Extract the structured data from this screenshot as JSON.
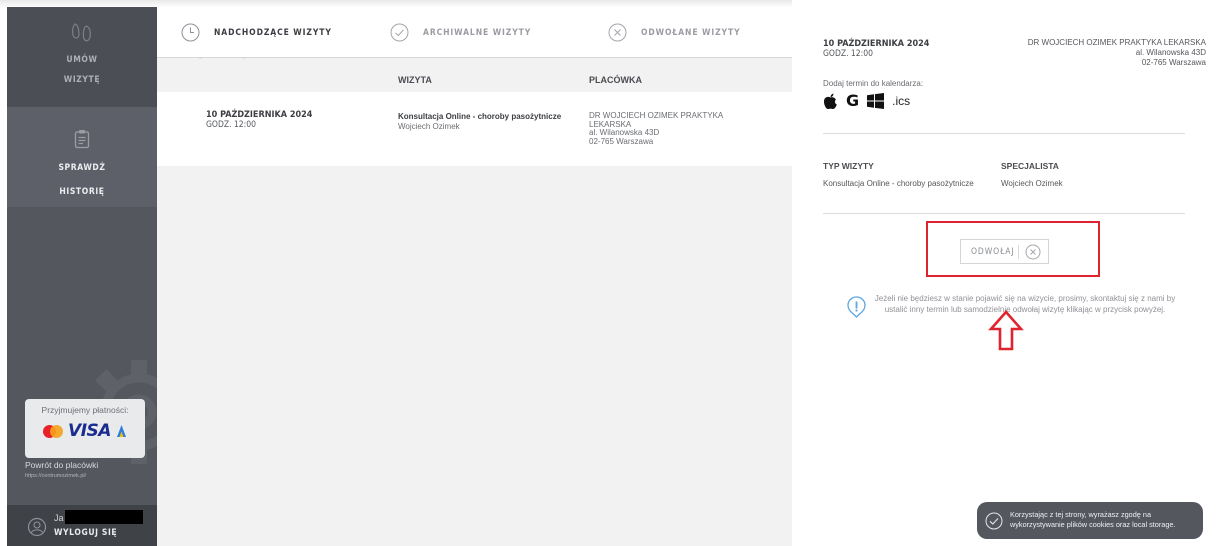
{
  "sidebar": {
    "book_label_1": "UMÓW",
    "book_label_2": "WIZYTĘ",
    "history_label_1": "SPRAWDŹ",
    "history_label_2": "HISTORIĘ",
    "payments_label": "Przyjmujemy płatności:",
    "payment_logos": [
      "mastercard-icon",
      "visa-icon",
      "blik-icon"
    ],
    "visa_text": "VISA",
    "back_link_label": "Powrót do placówki",
    "back_link_url": "https://centrumozimek.pl/",
    "user_name_visible": "Ja",
    "logout_label": "WYLOGUJ SIĘ",
    "colors": {
      "background": "#54575e",
      "active_block": "#5d6068"
    }
  },
  "tabs": [
    {
      "label": "NADCHODZĄCE WIZYTY",
      "icon": "clock-icon",
      "active": true
    },
    {
      "label": "ARCHIWALNE WIZYTY",
      "icon": "check-circle-icon",
      "active": false
    },
    {
      "label": "ODWOŁANE WIZYTY",
      "icon": "x-circle-icon",
      "active": false
    }
  ],
  "table": {
    "columns": [
      "",
      "WIZYTA",
      "PLACÓWKA"
    ],
    "rows": [
      {
        "date": "10 PAŹDZIERNIKA 2024",
        "time": "GODZ. 12:00",
        "visit": "Konsultacja Online - choroby pasożytnicze",
        "doctor": "Wojciech Ozimek",
        "clinic_lines": [
          "DR WOJCIECH OZIMEK PRAKTYKA",
          "LEKARSKA",
          "al. Wilanowska 43D",
          "02-765 Warszawa"
        ]
      }
    ]
  },
  "detail": {
    "date": "10 PAŹDZIERNIKA 2024",
    "time": "GODZ. 12:00",
    "clinic_lines": [
      "DR WOJCIECH OZIMEK PRAKTYKA LEKARSKA",
      "al. Wilanowska 43D",
      "02-765 Warszawa"
    ],
    "calendar_label": "Dodaj termin do kalendarza:",
    "calendar_icons": [
      "apple-icon",
      "google-icon",
      "windows-icon"
    ],
    "google_letter": "G",
    "ics_label": ".ics",
    "type_header": "TYP WIZYTY",
    "specialist_header": "SPECJALISTA",
    "type_value": "Konsultacja Online - choroby pasożytnicze",
    "specialist_value": "Wojciech Ozimek",
    "cancel_label": "ODWOŁAJ",
    "info_text": "Jeżeli nie będziesz w stanie pojawić się na wizycie, prosimy, skontaktuj się z nami by ustalić inny termin lub samodzielnie odwołaj wizytę klikając w przycisk powyżej."
  },
  "annotation": {
    "highlight_color": "#e0242f",
    "arrow_icon": "up-arrow-icon"
  },
  "cookie_banner": {
    "text": "Korzystając z tej strony, wyrażasz zgodę na wykorzystywanie plików cookies oraz local storage."
  }
}
